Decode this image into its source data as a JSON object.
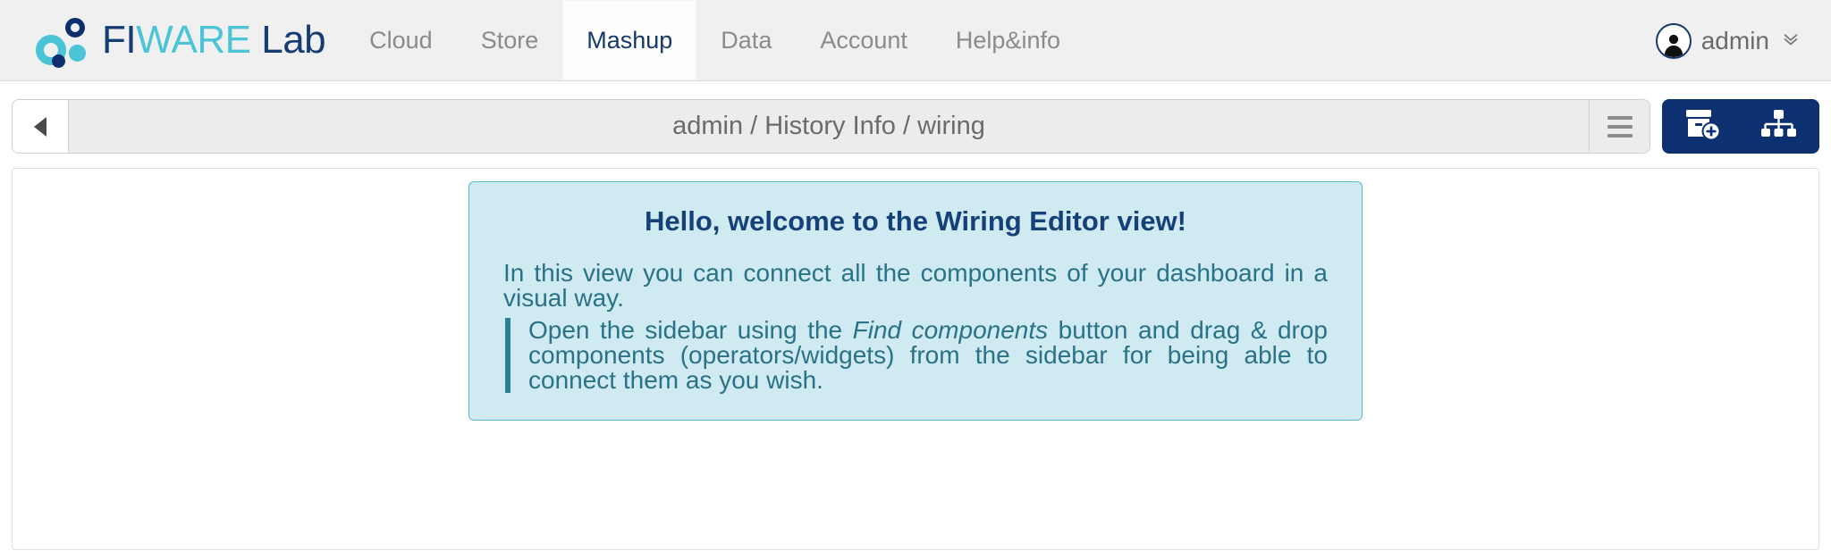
{
  "header": {
    "logo": {
      "fi": "FI",
      "wa": "WA",
      "re": "RE",
      "lab": "Lab",
      "icon": "fiware-circles-logo"
    },
    "nav": [
      {
        "label": "Cloud",
        "active": false
      },
      {
        "label": "Store",
        "active": false
      },
      {
        "label": "Mashup",
        "active": true
      },
      {
        "label": "Data",
        "active": false
      },
      {
        "label": "Account",
        "active": false
      },
      {
        "label": "Help&info",
        "active": false
      }
    ],
    "user": {
      "name": "admin",
      "avatar_icon": "user-avatar-icon",
      "caret_icon": "double-chevron-down-icon",
      "caret_glyph": "»"
    }
  },
  "toolbar": {
    "back_button_icon": "triangle-left-icon",
    "breadcrumb": "admin / History Info / wiring",
    "breadcrumb_parts": [
      "admin",
      "History Info",
      "wiring"
    ],
    "menu_button_icon": "hamburger-menu-icon",
    "actions": [
      {
        "icon": "add-component-box-icon",
        "name": "create-workspace-button"
      },
      {
        "icon": "sitemap-hierarchy-icon",
        "name": "wiring-view-button"
      }
    ]
  },
  "welcome": {
    "title": "Hello, welcome to the Wiring Editor view!",
    "paragraph1": "In this view you can connect all the components of your dashboard in a visual way.",
    "quote_before": "Open the sidebar using the ",
    "quote_emphasis": "Find components",
    "quote_after": " button and drag & drop components (operators/widgets) from the sidebar for being able to connect them as you wish."
  },
  "colors": {
    "brand_navy": "#0d3070",
    "brand_teal": "#4bc4d8",
    "topbar_bg": "#f0f0f0",
    "welcome_bg": "#cfeaf0",
    "welcome_border": "#5bb8cc",
    "welcome_text": "#2a7288",
    "welcome_title": "#15407a"
  }
}
